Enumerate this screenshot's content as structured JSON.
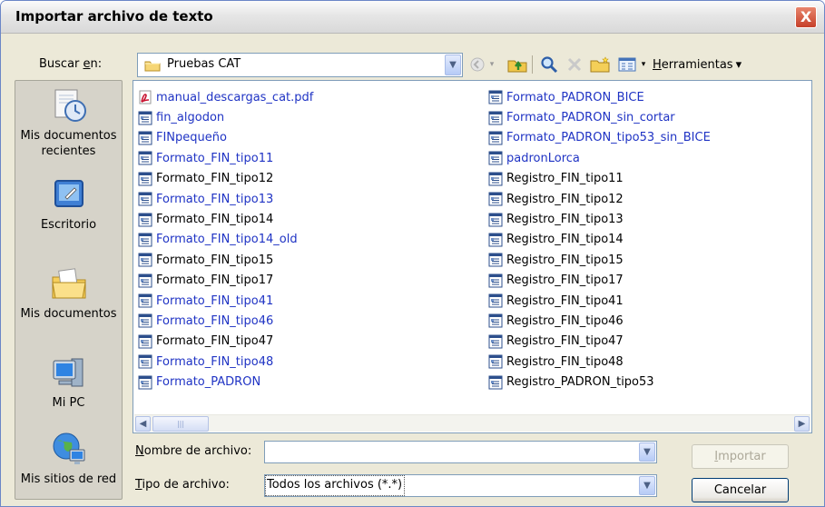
{
  "window": {
    "title": "Importar archivo de texto",
    "close_glyph": "X"
  },
  "lookin": {
    "label_pre": "Buscar ",
    "label_ul": "e",
    "label_post": "n:",
    "value": "Pruebas CAT"
  },
  "toolbar": {
    "tools_ul": "H",
    "tools_rest": "erramientas",
    "tools_arrow": "▾"
  },
  "places": [
    {
      "label_1": "Mis documentos",
      "label_2": "recientes",
      "icon": "recent-documents-icon"
    },
    {
      "label_1": "Escritorio",
      "label_2": "",
      "icon": "desktop-icon"
    },
    {
      "label_1": "Mis documentos",
      "label_2": "",
      "icon": "my-documents-icon"
    },
    {
      "label_1": "Mi PC",
      "label_2": "",
      "icon": "my-computer-icon"
    },
    {
      "label_1": "Mis sitios de red",
      "label_2": "",
      "icon": "network-places-icon"
    }
  ],
  "files_col1": [
    {
      "name": "manual_descargas_cat.pdf",
      "type": "pdf",
      "color": "blue"
    },
    {
      "name": "fin_algodon",
      "type": "text",
      "color": "blue"
    },
    {
      "name": "FINpequeño",
      "type": "text",
      "color": "blue"
    },
    {
      "name": "Formato_FIN_tipo11",
      "type": "text",
      "color": "blue"
    },
    {
      "name": "Formato_FIN_tipo12",
      "type": "text",
      "color": "black"
    },
    {
      "name": "Formato_FIN_tipo13",
      "type": "text",
      "color": "blue"
    },
    {
      "name": "Formato_FIN_tipo14",
      "type": "text",
      "color": "black"
    },
    {
      "name": "Formato_FIN_tipo14_old",
      "type": "text",
      "color": "blue"
    },
    {
      "name": "Formato_FIN_tipo15",
      "type": "text",
      "color": "black"
    },
    {
      "name": "Formato_FIN_tipo17",
      "type": "text",
      "color": "black"
    },
    {
      "name": "Formato_FIN_tipo41",
      "type": "text",
      "color": "blue"
    },
    {
      "name": "Formato_FIN_tipo46",
      "type": "text",
      "color": "blue"
    },
    {
      "name": "Formato_FIN_tipo47",
      "type": "text",
      "color": "black"
    },
    {
      "name": "Formato_FIN_tipo48",
      "type": "text",
      "color": "blue"
    },
    {
      "name": "Formato_PADRON",
      "type": "text",
      "color": "blue"
    }
  ],
  "files_col2": [
    {
      "name": "Formato_PADRON_BICE",
      "type": "text",
      "color": "blue"
    },
    {
      "name": "Formato_PADRON_sin_cortar",
      "type": "text",
      "color": "blue"
    },
    {
      "name": "Formato_PADRON_tipo53_sin_BICE",
      "type": "text",
      "color": "blue"
    },
    {
      "name": "padronLorca",
      "type": "text",
      "color": "blue"
    },
    {
      "name": "Registro_FIN_tipo11",
      "type": "text",
      "color": "black"
    },
    {
      "name": "Registro_FIN_tipo12",
      "type": "text",
      "color": "black"
    },
    {
      "name": "Registro_FIN_tipo13",
      "type": "text",
      "color": "black"
    },
    {
      "name": "Registro_FIN_tipo14",
      "type": "text",
      "color": "black"
    },
    {
      "name": "Registro_FIN_tipo15",
      "type": "text",
      "color": "black"
    },
    {
      "name": "Registro_FIN_tipo17",
      "type": "text",
      "color": "black"
    },
    {
      "name": "Registro_FIN_tipo41",
      "type": "text",
      "color": "black"
    },
    {
      "name": "Registro_FIN_tipo46",
      "type": "text",
      "color": "black"
    },
    {
      "name": "Registro_FIN_tipo47",
      "type": "text",
      "color": "black"
    },
    {
      "name": "Registro_FIN_tipo48",
      "type": "text",
      "color": "black"
    },
    {
      "name": "Registro_PADRON_tipo53",
      "type": "text",
      "color": "black"
    }
  ],
  "filename": {
    "label_ul": "N",
    "label_rest": "ombre de archivo:",
    "value": ""
  },
  "filetype": {
    "label_ul": "T",
    "label_rest": "ipo de archivo:",
    "value": "Todos los archivos (*.*)"
  },
  "buttons": {
    "import_ul": "I",
    "import_rest": "mportar",
    "cancel": "Cancelar"
  },
  "colors": {
    "link_blue": "#1f33c4",
    "dialog_bg": "#ece9d8"
  }
}
